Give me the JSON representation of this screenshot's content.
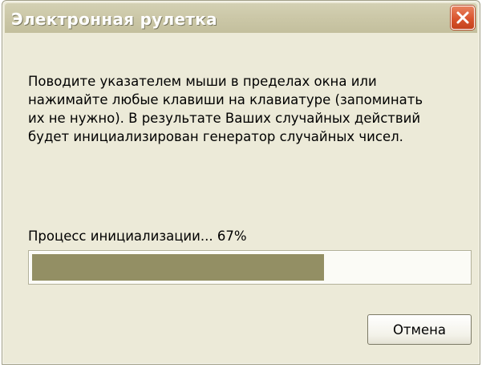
{
  "window": {
    "title": "Электронная рулетка",
    "close_icon": "close-icon"
  },
  "message": {
    "lines": [
      "Поводите указателем мыши в пределах окна или",
      "нажимайте любые клавиши на клавиатуре (запоминать",
      "их не нужно). В результате Ваших случайных действий",
      "будет инициализирован генератор случайных чисел."
    ]
  },
  "progress": {
    "label": "Процесс инициализации... 67%",
    "value": 0.67
  },
  "buttons": {
    "cancel_label": "Отмена"
  },
  "colors": {
    "titlebar": "#ccc8a8",
    "window_background": "#ecead8",
    "progress_fill": "#938f64",
    "close_button": "#d9542e"
  }
}
